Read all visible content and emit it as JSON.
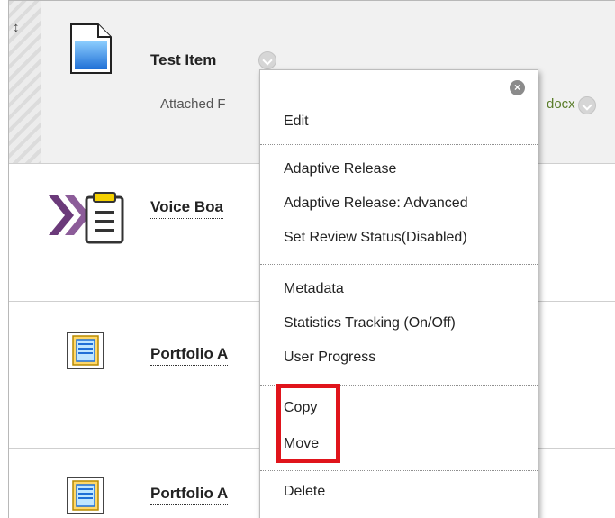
{
  "items": [
    {
      "title": "Test Item",
      "attached_label": "Attached F",
      "file_text": "docx"
    },
    {
      "title": "Voice Boa"
    },
    {
      "title": "Portfolio A"
    },
    {
      "title": "Portfolio A"
    }
  ],
  "menu": {
    "close_glyph": "×",
    "edit": "Edit",
    "adaptive_release": "Adaptive Release",
    "adaptive_release_advanced": "Adaptive Release: Advanced",
    "set_review_status": "Set Review Status(Disabled)",
    "metadata": "Metadata",
    "statistics_tracking": "Statistics Tracking (On/Off)",
    "user_progress": "User Progress",
    "copy": "Copy",
    "move": "Move",
    "delete": "Delete"
  },
  "icons": {
    "drag": "drag-handle-icon",
    "document": "document-icon",
    "voiceboard": "voice-board-icon",
    "portfolio": "portfolio-icon",
    "menu_toggle": "chevron-down-icon",
    "close": "close-icon"
  },
  "colors": {
    "highlight": "#e0141b",
    "file_link": "#5a7d2a",
    "voice_board_accent": "#6b3a7a"
  }
}
